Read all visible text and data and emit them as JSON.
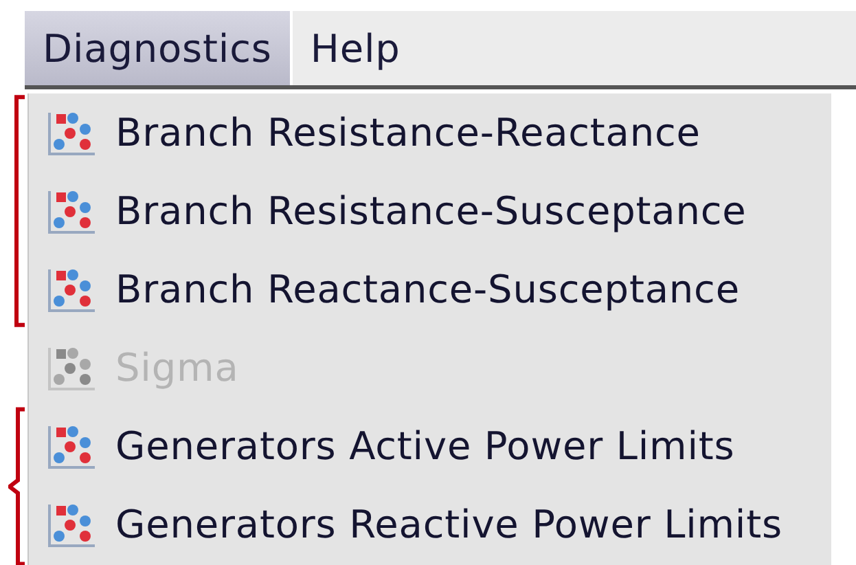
{
  "menubar": [
    {
      "label": "Diagnostics",
      "selected": true
    },
    {
      "label": "Help",
      "selected": false
    }
  ],
  "menu": {
    "groups": [
      {
        "kind": "square",
        "items": [
          {
            "label": "Branch Resistance-Reactance",
            "disabled": false
          },
          {
            "label": "Branch Resistance-Susceptance",
            "disabled": false
          },
          {
            "label": "Branch Reactance-Susceptance",
            "disabled": false
          }
        ]
      },
      {
        "kind": "plain",
        "items": [
          {
            "label": "Sigma",
            "disabled": true
          }
        ]
      },
      {
        "kind": "curly",
        "items": [
          {
            "label": "Generators Active Power Limits",
            "disabled": false
          },
          {
            "label": "Generators Reactive Power Limits",
            "disabled": false
          }
        ]
      }
    ]
  }
}
